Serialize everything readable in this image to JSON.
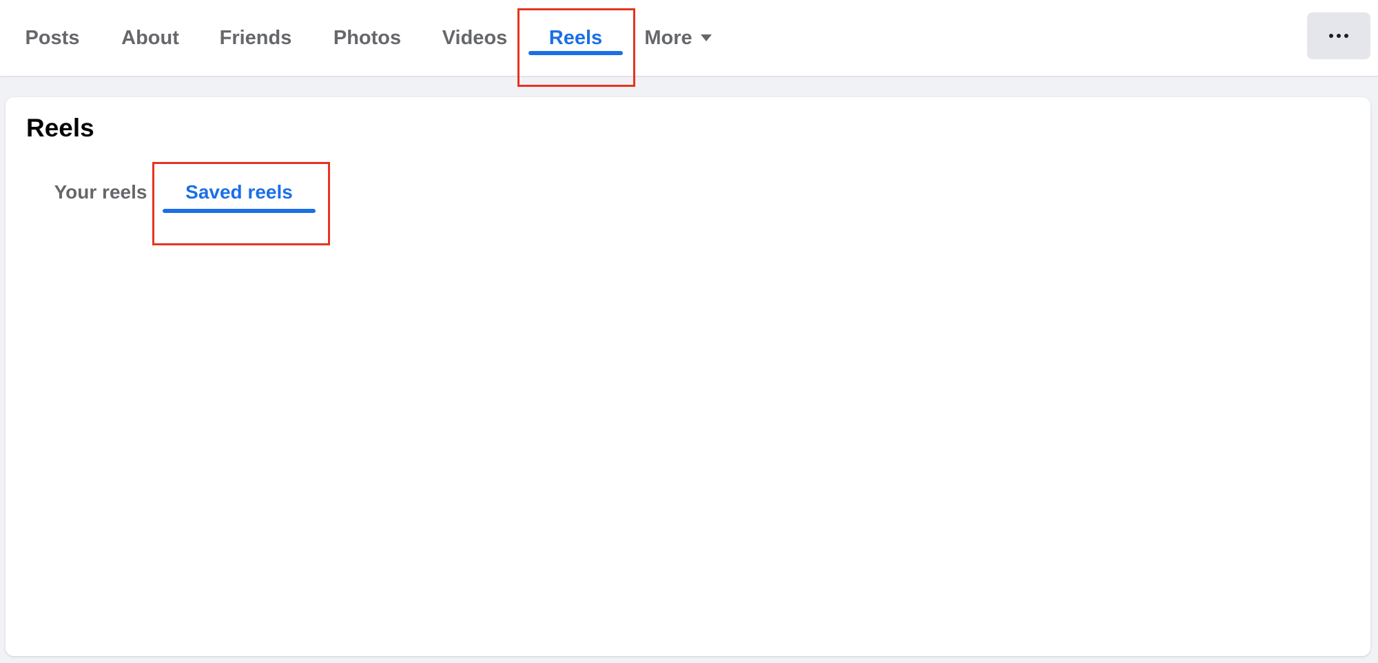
{
  "nav": {
    "tabs": [
      {
        "label": "Posts",
        "active": false
      },
      {
        "label": "About",
        "active": false
      },
      {
        "label": "Friends",
        "active": false
      },
      {
        "label": "Photos",
        "active": false
      },
      {
        "label": "Videos",
        "active": false
      },
      {
        "label": "Reels",
        "active": true
      },
      {
        "label": "More",
        "active": false,
        "icon": "caret-down-icon"
      }
    ],
    "overflow_icon": "more-dots-icon"
  },
  "reels_section": {
    "title": "Reels",
    "sub_tabs": [
      {
        "label": "Your reels",
        "active": false
      },
      {
        "label": "Saved reels",
        "active": true
      }
    ]
  },
  "annotations": {
    "highlight_color": "#e8321f",
    "highlighted": [
      "Reels tab",
      "Saved reels tab"
    ]
  },
  "colors": {
    "accent": "#1b6fe6",
    "inactive_text": "#65676b",
    "page_background": "#f0f2f5"
  }
}
